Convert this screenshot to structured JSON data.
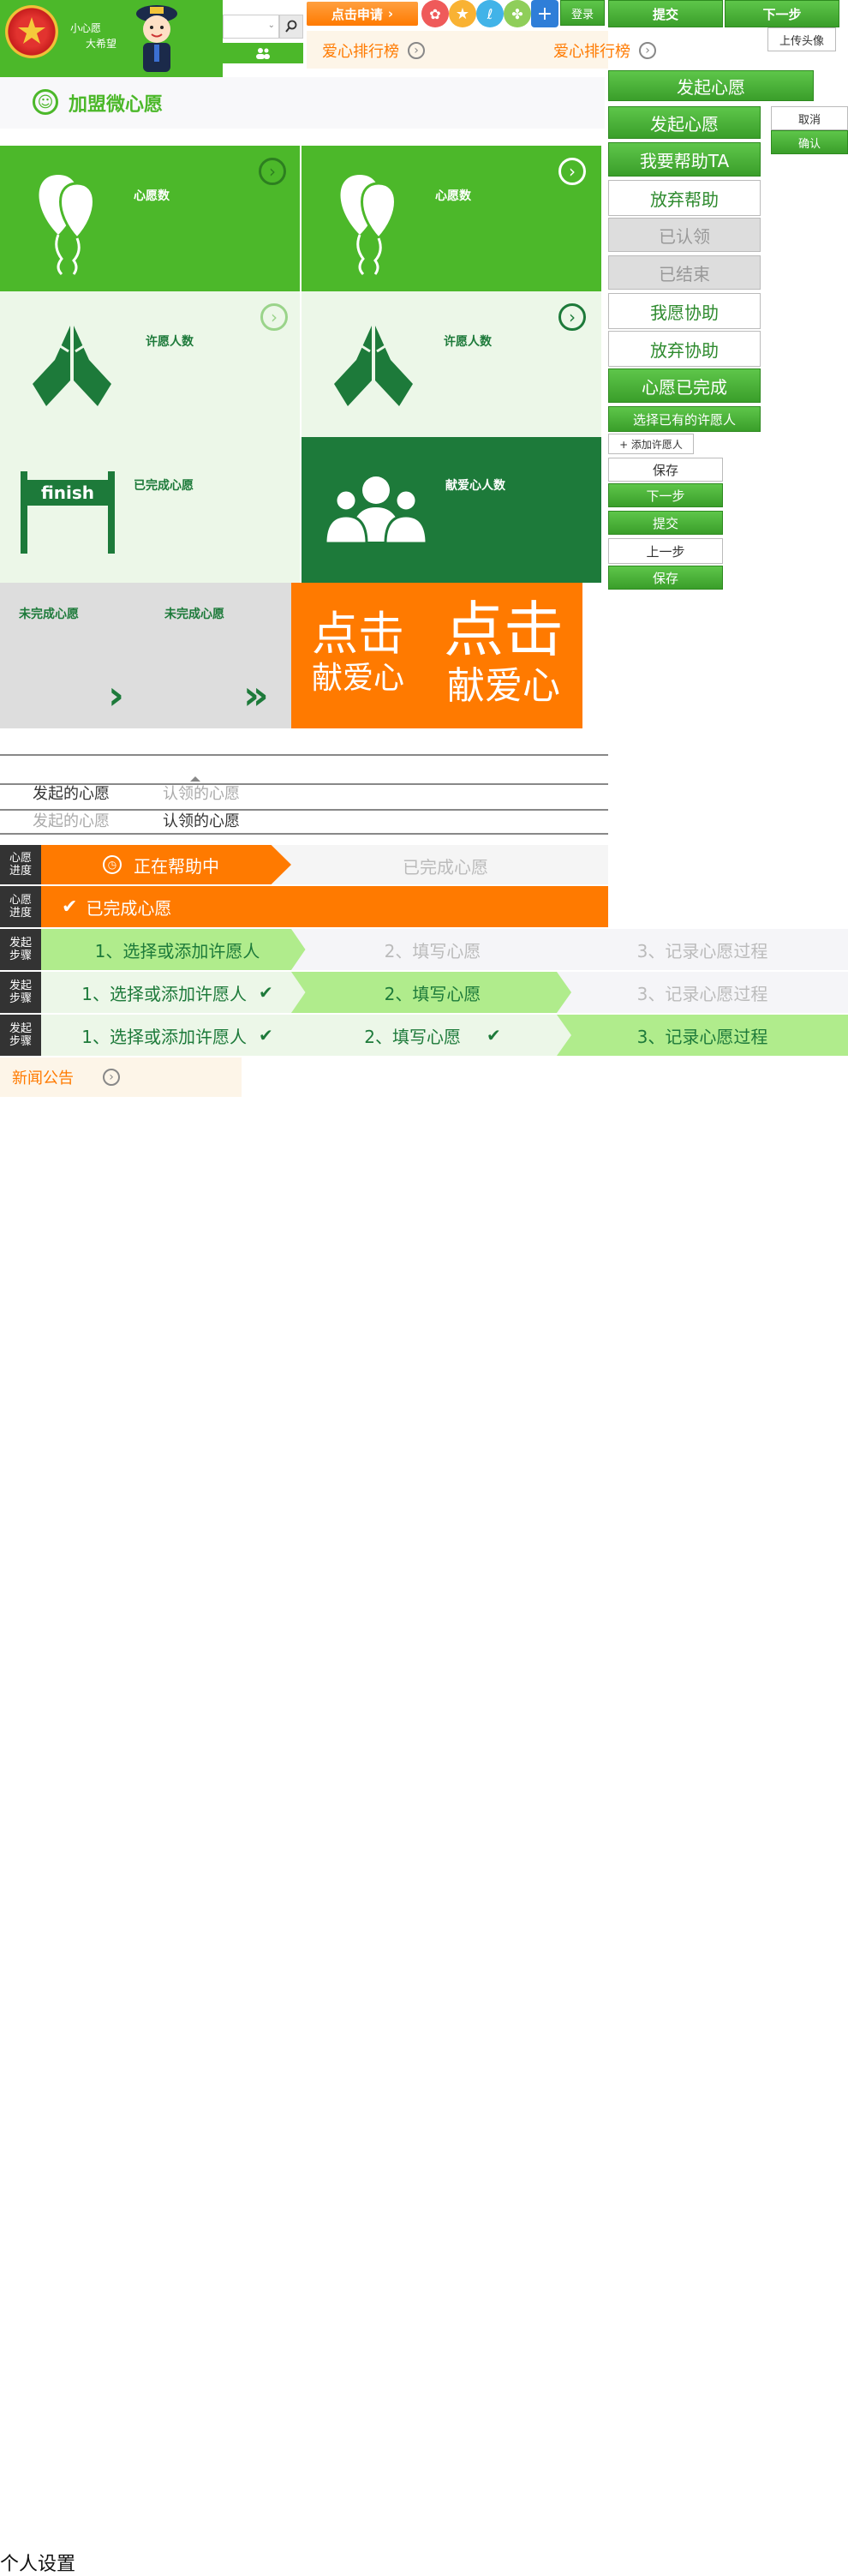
{
  "header": {
    "logo_lines": [
      "小心愿",
      "大希望"
    ],
    "apply_button": "点击申请",
    "login_button": "登录",
    "ranking_label_1": "爱心排行榜",
    "ranking_label_2": "爱心排行榜"
  },
  "buttons": {
    "submit": "提交",
    "next": "下一步",
    "upload_avatar": "上传头像",
    "launch_wish_main": "发起心愿",
    "launch_wish": "发起心愿",
    "help_ta": "我要帮助TA",
    "give_up_help": "放弃帮助",
    "claimed": "已认领",
    "ended": "已结束",
    "wish_assist": "我愿协助",
    "give_up_assist": "放弃协助",
    "wish_completed": "心愿已完成",
    "select_wisher": "选择已有的许愿人",
    "add_wisher": "+ 添加许愿人",
    "save": "保存",
    "next_step": "下一步",
    "submit_small": "提交",
    "prev_step": "上一步",
    "save_green": "保存",
    "cancel": "取消",
    "confirm": "确认"
  },
  "join_title": "加盟微心愿",
  "tiles": {
    "wish_count": "心愿数",
    "wisher_count": "许愿人数",
    "completed_wishes": "已完成心愿",
    "donor_count": "献爱心人数",
    "uncompleted_1": "未完成心愿",
    "uncompleted_2": "未完成心愿",
    "finish_text": "finish",
    "click_1": "点击",
    "love_1": "献爱心",
    "click_2": "点击",
    "love_2": "献爱心"
  },
  "tabs": {
    "row1": [
      "发起的心愿",
      "认领的心愿"
    ],
    "row2": [
      "发起的心愿",
      "认领的心愿"
    ]
  },
  "progress": {
    "tag": "心愿\n进度",
    "helping": "正在帮助中",
    "completed": "已完成心愿",
    "completed_full": "已完成心愿"
  },
  "steps": {
    "tag": "发起\n步骤",
    "step1": "1、选择或添加许愿人",
    "step2": "2、填写心愿",
    "step3": "3、记录心愿过程"
  },
  "news": "新闻公告",
  "footer_text": "个人设置",
  "colors": {
    "green": "#4cb82a",
    "dark_green": "#1d7a3a",
    "orange": "#ff7a00",
    "light_green_bg": "#ecf7e8",
    "step_active": "#b0ec8c"
  }
}
